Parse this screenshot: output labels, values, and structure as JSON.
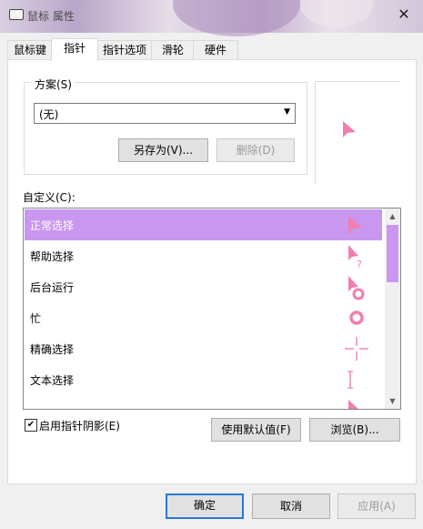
{
  "window": {
    "title": "鼠标 属性",
    "close_glyph": "✕"
  },
  "tabs": [
    {
      "label": "鼠标键"
    },
    {
      "label": "指针"
    },
    {
      "label": "指针选项"
    },
    {
      "label": "滑轮"
    },
    {
      "label": "硬件"
    }
  ],
  "active_tab": "指针",
  "scheme": {
    "label": "方案(S)",
    "selected": "(无)",
    "save_as": "另存为(V)...",
    "delete": "删除(D)"
  },
  "customize": {
    "label": "自定义(C):",
    "items": [
      {
        "name": "正常选择",
        "icon": "arrow-cursor-icon"
      },
      {
        "name": "帮助选择",
        "icon": "help-cursor-icon"
      },
      {
        "name": "后台运行",
        "icon": "working-cursor-icon"
      },
      {
        "name": "忙",
        "icon": "busy-cursor-icon"
      },
      {
        "name": "精确选择",
        "icon": "crosshair-cursor-icon"
      },
      {
        "name": "文本选择",
        "icon": "text-cursor-icon"
      }
    ],
    "selected_index": 0
  },
  "shadow": {
    "label": "启用指针阴影(E)",
    "checked": true
  },
  "buttons": {
    "use_default": "使用默认值(F)",
    "browse": "浏览(B)...",
    "ok": "确定",
    "cancel": "取消",
    "apply": "应用(A)"
  },
  "colors": {
    "accent": "#c997ef",
    "cursor_pink": "#f07fb0",
    "default_border": "#2b78d4"
  }
}
